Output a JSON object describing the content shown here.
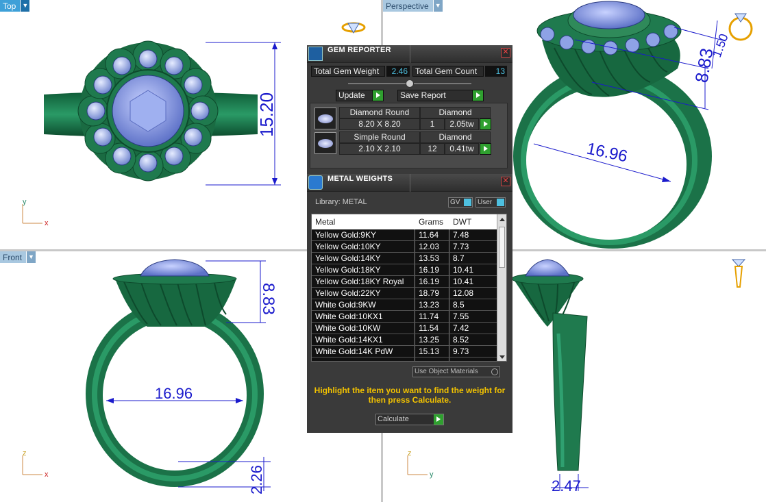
{
  "viewports": {
    "top": {
      "label": "Top"
    },
    "perspective": {
      "label": "Perspective"
    },
    "front": {
      "label": "Front"
    },
    "right": {
      "label": ""
    }
  },
  "dimensions": {
    "top_height": "15.20",
    "persp_height": "8.83",
    "persp_depth": "1.50",
    "persp_diameter": "16.96",
    "front_height": "8.83",
    "front_diameter": "16.96",
    "front_band": "2.26",
    "side_band": "2.47"
  },
  "axes": {
    "x": "x",
    "y": "y",
    "z": "z"
  },
  "gem_reporter": {
    "title": "GEM REPORTER",
    "total_weight_label": "Total Gem Weight",
    "total_weight_value": "2.46",
    "total_count_label": "Total Gem Count",
    "total_count_value": "13",
    "update_label": "Update",
    "save_label": "Save Report",
    "gems": [
      {
        "shape": "Diamond Round",
        "size": "8.20 X 8.20",
        "material": "Diamond",
        "count": "1",
        "weight": "2.05tw"
      },
      {
        "shape": "Simple Round",
        "size": "2.10 X 2.10",
        "material": "Diamond",
        "count": "12",
        "weight": "0.41tw"
      }
    ]
  },
  "metal_weights": {
    "title": "METAL WEIGHTS",
    "library": "Library: METAL",
    "toggle_gv": "GV",
    "toggle_user": "User",
    "columns": [
      "Metal",
      "Grams",
      "DWT"
    ],
    "rows": [
      [
        "Yellow Gold:9KY",
        "11.64",
        "7.48"
      ],
      [
        "Yellow Gold:10KY",
        "12.03",
        "7.73"
      ],
      [
        "Yellow Gold:14KY",
        "13.53",
        "8.7"
      ],
      [
        "Yellow Gold:18KY",
        "16.19",
        "10.41"
      ],
      [
        "Yellow Gold:18KY Royal",
        "16.19",
        "10.41"
      ],
      [
        "Yellow Gold:22KY",
        "18.79",
        "12.08"
      ],
      [
        "White Gold:9KW",
        "13.23",
        "8.5"
      ],
      [
        "White Gold:10KX1",
        "11.74",
        "7.55"
      ],
      [
        "White Gold:10KW",
        "11.54",
        "7.42"
      ],
      [
        "White Gold:14KX1",
        "13.25",
        "8.52"
      ],
      [
        "White Gold:14K PdW",
        "15.13",
        "9.73"
      ]
    ],
    "use_object_label": "Use Object Materials",
    "hint": "Highlight the item you want to find the weight for then press Calculate.",
    "calculate_label": "Calculate"
  },
  "colors": {
    "ring": "#1f7a4e",
    "gem": "#8ea2e6",
    "dimension": "#1a1acc",
    "accent": "#f2c200"
  }
}
